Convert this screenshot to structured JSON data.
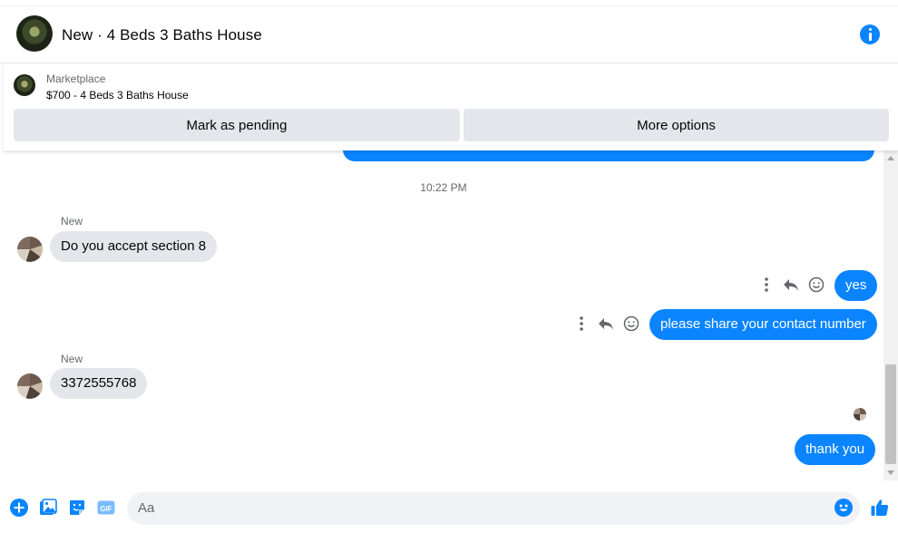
{
  "header": {
    "title": "New · 4 Beds 3 Baths House",
    "icons": {
      "avatar": "listing-photo",
      "info": "info-icon"
    },
    "accent": "#0a84ff"
  },
  "marketplace": {
    "label": "Marketplace",
    "listing": "$700 - 4 Beds 3 Baths House",
    "buttons": {
      "pending": "Mark as pending",
      "more": "More options"
    }
  },
  "chat": {
    "timestamp": "10:22 PM",
    "messages": [
      {
        "from": "them",
        "sender": "New",
        "text": "Do you accept section 8"
      },
      {
        "from": "me",
        "text": "yes"
      },
      {
        "from": "me",
        "text": "please share your contact number"
      },
      {
        "from": "them",
        "sender": "New",
        "text": "3372555768"
      },
      {
        "from": "me",
        "text": "thank you"
      }
    ],
    "message_actions": [
      "more-icon",
      "reply-icon",
      "react-icon"
    ],
    "colors": {
      "outgoing": "#0a84ff",
      "incoming": "#e4e6eb"
    }
  },
  "composer": {
    "placeholder": "Aa",
    "icons": [
      "plus-icon",
      "image-icon",
      "sticker-icon",
      "gif-icon",
      "emoji-icon",
      "like-icon"
    ],
    "gif_label": "GIF"
  }
}
